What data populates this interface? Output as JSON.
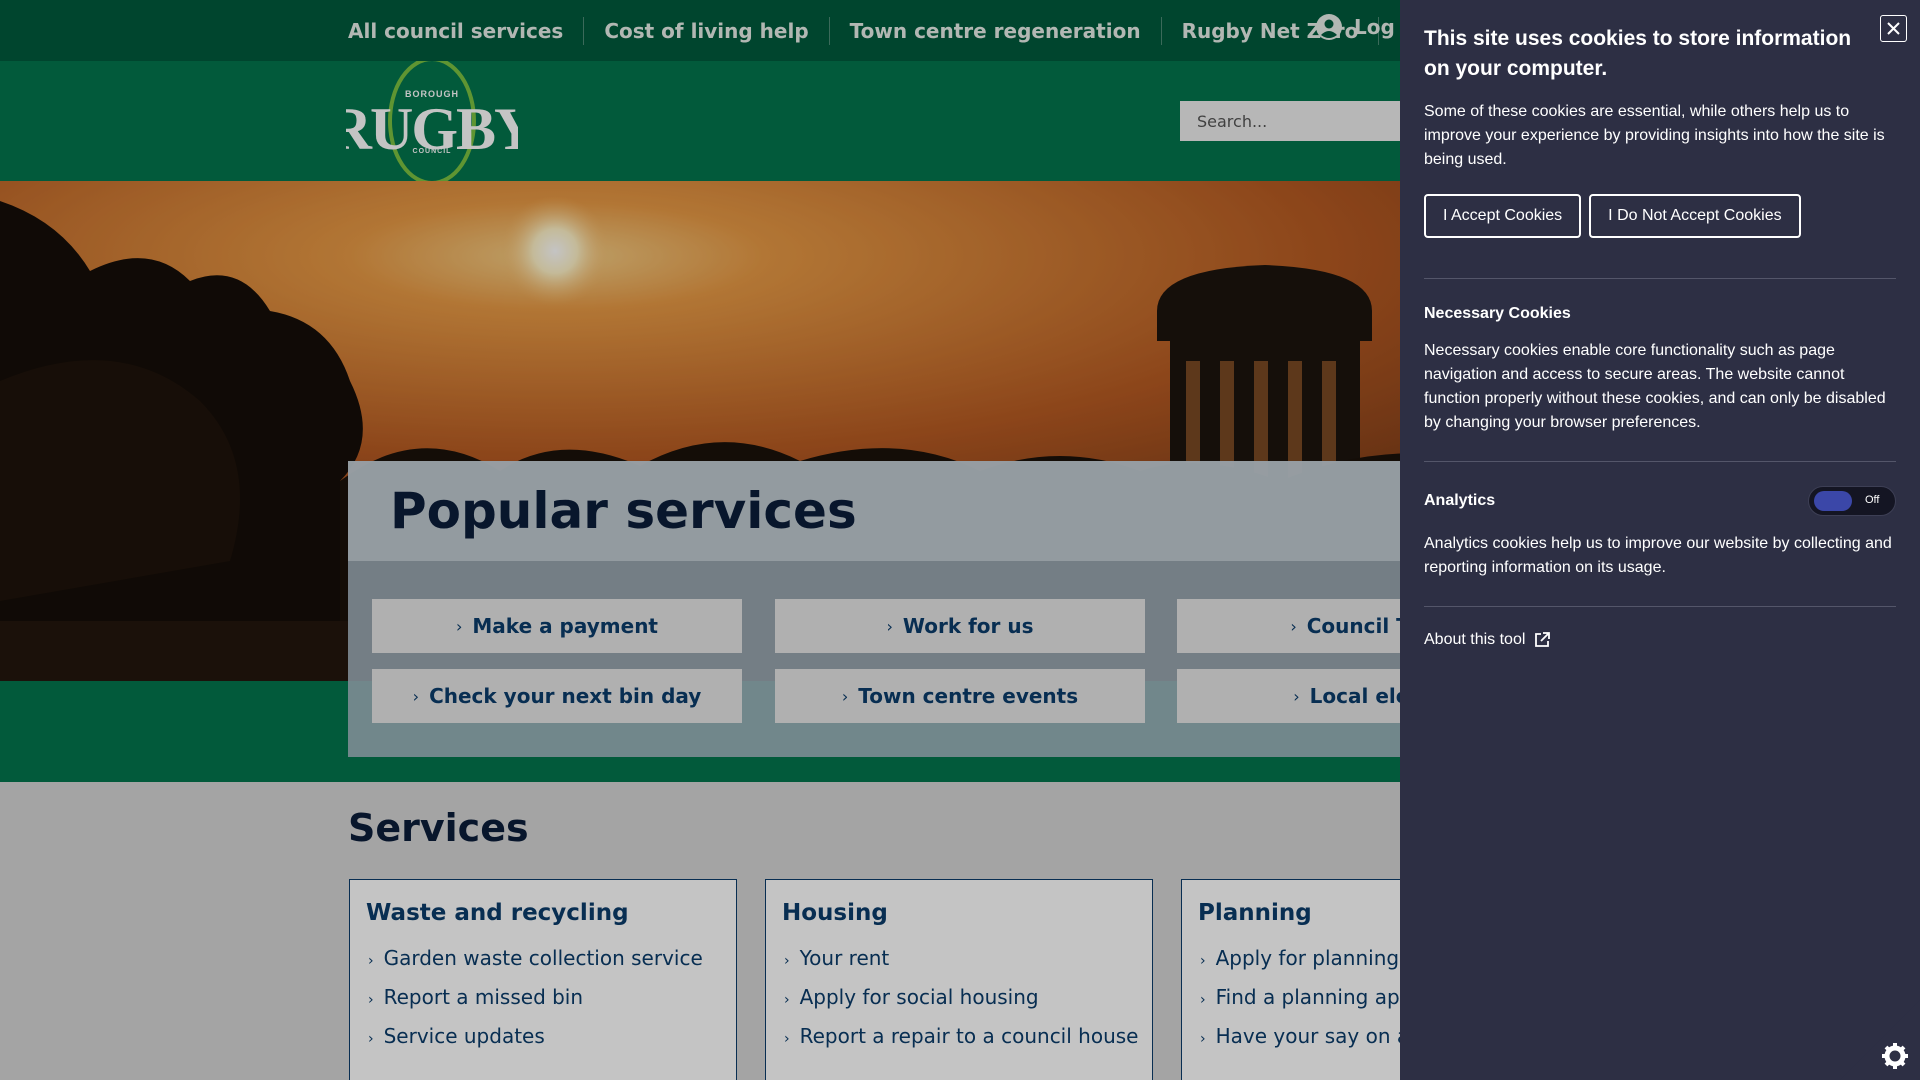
{
  "topnav": {
    "items": [
      "All council services",
      "Cost of living help",
      "Town centre regeneration",
      "Rugby Net Zero"
    ],
    "login_label": "Log i"
  },
  "header": {
    "search_placeholder": "Search...",
    "logo": {
      "top_text": "BOROUGH",
      "main_text": "RUGBY",
      "bottom_text": "COUNCIL"
    }
  },
  "popular": {
    "title": "Popular services",
    "buttons": [
      "Make a payment",
      "Work for us",
      "Council Tax",
      "Check your next bin day",
      "Town centre events",
      "Local elect"
    ]
  },
  "services": {
    "title": "Services",
    "cards": [
      {
        "title": "Waste and recycling",
        "links": [
          "Garden waste collection service",
          "Report a missed bin",
          "Service updates"
        ]
      },
      {
        "title": "Housing",
        "links": [
          "Your rent",
          "Apply for social housing",
          "Report a repair to a council house"
        ]
      },
      {
        "title": "Planning",
        "links": [
          "Apply for planning pe",
          "Find a planning appli",
          "Have your say on a p"
        ]
      }
    ]
  },
  "cookie": {
    "heading": "This site uses cookies to store information on your computer.",
    "intro": "Some of these cookies are essential, while others help us to improve your experience by providing insights into how the site is being used.",
    "accept_label": "I Accept Cookies",
    "reject_label": "I Do Not Accept Cookies",
    "necessary_title": "Necessary Cookies",
    "necessary_text": "Necessary cookies enable core functionality such as page navigation and access to secure areas. The website cannot function properly without these cookies, and can only be disabled by changing your browser preferences.",
    "analytics_title": "Analytics",
    "analytics_toggle_label": "Off",
    "analytics_enabled": false,
    "analytics_text": "Analytics cookies help us to improve our website by collecting and reporting information on its usage.",
    "about_label": "About this tool"
  },
  "colors": {
    "topbar": "#015a3c",
    "header_green": "#03754d",
    "navy": "#0b1d3a",
    "link_blue": "#0b3d6b",
    "cookie_panel": "#2d2f44"
  },
  "icons": [
    "user-icon",
    "close-icon",
    "chevron-right-icon",
    "external-link-icon",
    "gear-icon"
  ]
}
